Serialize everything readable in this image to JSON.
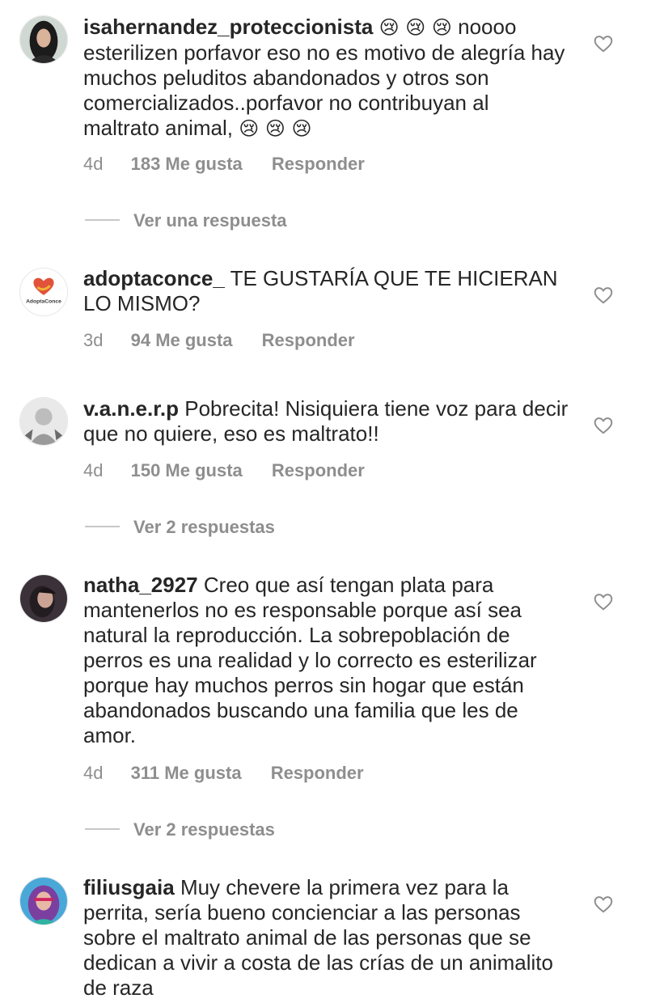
{
  "comments": [
    {
      "username": "isahernandez_proteccionista",
      "emoji_lead": "😢 😢 😢",
      "text": "noooo esterilizen porfavor eso no es motivo de alegría hay muchos peluditos abandonados y otros son comercializados..porfavor no contribuyan al maltrato animal,",
      "emoji_trail": "😢 😢 😢",
      "time": "4d",
      "likes": "183 Me gusta",
      "reply": "Responder",
      "view_replies": "Ver una respuesta"
    },
    {
      "username": "adoptaconce_",
      "text": "TE GUSTARÍA QUE TE HICIERAN LO MISMO?",
      "avatar_label": "AdoptaConce",
      "time": "3d",
      "likes": "94 Me gusta",
      "reply": "Responder"
    },
    {
      "username": "v.a.n.e.r.p",
      "text": "Pobrecita! Nisiquiera tiene voz para decir que no quiere, eso es maltrato!!",
      "time": "4d",
      "likes": "150 Me gusta",
      "reply": "Responder",
      "view_replies": "Ver 2 respuestas"
    },
    {
      "username": "natha_2927",
      "text": "Creo que así tengan plata para mantenerlos no es responsable porque así sea natural la reproducción. La sobrepoblación de perros es una realidad y lo correcto es esterilizar porque hay muchos perros sin hogar que están abandonados buscando una familia que les de amor.",
      "time": "4d",
      "likes": "311 Me gusta",
      "reply": "Responder",
      "view_replies": "Ver 2 respuestas"
    },
    {
      "username": "filiusgaia",
      "text": "Muy chevere la primera vez para la perrita, sería bueno concienciar a las personas sobre el maltrato animal de las personas que se dedican a vivir a costa de las crías de un animalito de raza"
    }
  ],
  "icons": {
    "like": "heart-outline-icon"
  },
  "colors": {
    "text": "#262626",
    "secondary": "#8e8e8e",
    "avatar_brand": "#e0533a"
  }
}
